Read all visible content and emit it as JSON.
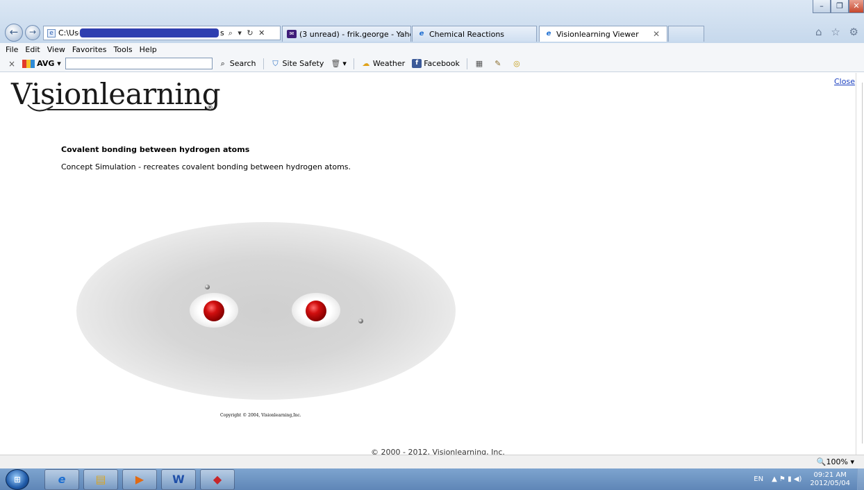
{
  "browser": {
    "address_prefix": "C:\\User",
    "address_suffix": "s",
    "address_controls": "⌕ ▾ ↻ ✕",
    "tabs": [
      {
        "label": "(3 unread) - frik.george - Yaho...",
        "icon": "mail-icon"
      },
      {
        "label": "Chemical Reactions",
        "icon": "ie-icon"
      },
      {
        "label": "Visionlearning Viewer",
        "icon": "ie-icon",
        "active": true
      }
    ],
    "right_icons": "⌂ ☆ ⚙"
  },
  "menu": [
    "File",
    "Edit",
    "View",
    "Favorites",
    "Tools",
    "Help"
  ],
  "toolbar": {
    "close_glyph": "×",
    "avg_label": "AVG ▾",
    "search_label": "Search",
    "site_safety_label": "Site Safety",
    "weather_label": "Weather",
    "facebook_label": "Facebook"
  },
  "page": {
    "logo_text": "Visionlearning",
    "logo_reg": "®",
    "close_link": "Close",
    "sim_title": "Covalent bonding between hydrogen atoms",
    "sim_description": "Concept Simulation - recreates covalent bonding between hydrogen atoms.",
    "sim_copyright": "Copyright © 2004, Visionlearning,Inc.",
    "footer": "© 2000 - 2012, Visionlearning, Inc."
  },
  "status": {
    "zoom": "🔍100%  ▾"
  },
  "taskbar": {
    "language": "EN",
    "tray_icons": "▲  ⚑  ▮  ◀)",
    "time": "09:21 AM",
    "date": "2012/05/04"
  }
}
